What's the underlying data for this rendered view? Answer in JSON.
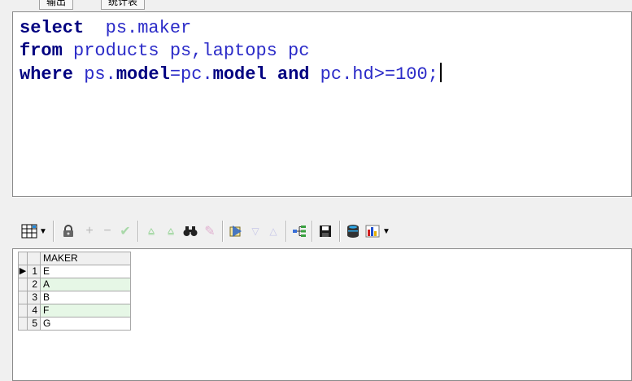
{
  "tabs": [
    {
      "label": "输出"
    },
    {
      "label": "统计表"
    }
  ],
  "editor": {
    "lines": [
      [
        {
          "t": "select",
          "c": "kw"
        },
        {
          "t": "  ps.maker",
          "c": ""
        }
      ],
      [
        {
          "t": "from",
          "c": "kw"
        },
        {
          "t": " products ps,laptops pc",
          "c": ""
        }
      ],
      [
        {
          "t": "where",
          "c": "kw"
        },
        {
          "t": " ps.",
          "c": ""
        },
        {
          "t": "model",
          "c": "kw"
        },
        {
          "t": "=pc.",
          "c": ""
        },
        {
          "t": "model",
          "c": "kw"
        },
        {
          "t": " ",
          "c": ""
        },
        {
          "t": "and",
          "c": "kw"
        },
        {
          "t": " pc.hd>=100;",
          "c": ""
        }
      ]
    ]
  },
  "grid": {
    "header": "MAKER",
    "rows": [
      {
        "num": "1",
        "val": "E",
        "current": true
      },
      {
        "num": "2",
        "val": "A",
        "current": false
      },
      {
        "num": "3",
        "val": "B",
        "current": false
      },
      {
        "num": "4",
        "val": "F",
        "current": false
      },
      {
        "num": "5",
        "val": "G",
        "current": false
      }
    ]
  },
  "colors": {
    "keyword": "#000080",
    "text": "#2b2bc8",
    "row_alt": "#e6f7e6"
  },
  "toolbar_icons": [
    "grid-icon",
    "dropdown-icon",
    "lock-icon",
    "plus-icon",
    "minus-icon",
    "check-icon",
    "filter-down-icon",
    "filter-up-icon",
    "binoculars-icon",
    "eraser-icon",
    "query-icon",
    "triangle-down-icon",
    "triangle-up-icon",
    "tree-icon",
    "save-icon",
    "database-icon",
    "chart-icon",
    "chart-dropdown-icon"
  ]
}
